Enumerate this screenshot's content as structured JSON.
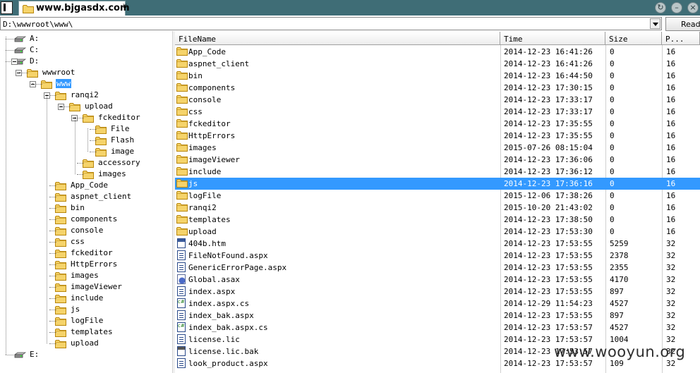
{
  "window": {
    "tab_title": "www.bjgasdx.com",
    "tab_close": "x",
    "btn_refresh": "↻",
    "btn_minimize": "–",
    "btn_close": "×"
  },
  "address": {
    "path": "D:\\wwwroot\\www\\",
    "read_button": "Read"
  },
  "tree": [
    {
      "label": "A:",
      "type": "drive",
      "depth": 0
    },
    {
      "label": "C:",
      "type": "drive",
      "depth": 0
    },
    {
      "label": "D:",
      "type": "drive",
      "depth": 0,
      "expanded": true
    },
    {
      "label": "wwwroot",
      "type": "folder",
      "depth": 1,
      "expanded": true
    },
    {
      "label": "www",
      "type": "folder",
      "depth": 2,
      "expanded": true,
      "selected": true
    },
    {
      "label": "ranqi2",
      "type": "folder",
      "depth": 3,
      "expanded": true
    },
    {
      "label": "upload",
      "type": "folder",
      "depth": 4,
      "expanded": true
    },
    {
      "label": "fckeditor",
      "type": "folder",
      "depth": 5,
      "expanded": true
    },
    {
      "label": "File",
      "type": "folder",
      "depth": 6
    },
    {
      "label": "Flash",
      "type": "folder",
      "depth": 6
    },
    {
      "label": "image",
      "type": "folder",
      "depth": 6
    },
    {
      "label": "accessory",
      "type": "folder",
      "depth": 5
    },
    {
      "label": "images",
      "type": "folder",
      "depth": 5
    },
    {
      "label": "App_Code",
      "type": "folder",
      "depth": 3
    },
    {
      "label": "aspnet_client",
      "type": "folder",
      "depth": 3
    },
    {
      "label": "bin",
      "type": "folder",
      "depth": 3
    },
    {
      "label": "components",
      "type": "folder",
      "depth": 3
    },
    {
      "label": "console",
      "type": "folder",
      "depth": 3
    },
    {
      "label": "css",
      "type": "folder",
      "depth": 3
    },
    {
      "label": "fckeditor",
      "type": "folder",
      "depth": 3
    },
    {
      "label": "HttpErrors",
      "type": "folder",
      "depth": 3
    },
    {
      "label": "images",
      "type": "folder",
      "depth": 3
    },
    {
      "label": "imageViewer",
      "type": "folder",
      "depth": 3
    },
    {
      "label": "include",
      "type": "folder",
      "depth": 3
    },
    {
      "label": "js",
      "type": "folder",
      "depth": 3
    },
    {
      "label": "logFile",
      "type": "folder",
      "depth": 3
    },
    {
      "label": "templates",
      "type": "folder",
      "depth": 3
    },
    {
      "label": "upload",
      "type": "folder",
      "depth": 3
    },
    {
      "label": "E:",
      "type": "drive",
      "depth": 0
    }
  ],
  "list": {
    "columns": [
      "FileName",
      "Time",
      "Size",
      "P..."
    ],
    "rows": [
      {
        "name": "App_Code",
        "time": "2014-12-23 16:41:26",
        "size": "0",
        "p": "16",
        "icon": "folder"
      },
      {
        "name": "aspnet_client",
        "time": "2014-12-23 16:41:26",
        "size": "0",
        "p": "16",
        "icon": "folder"
      },
      {
        "name": "bin",
        "time": "2014-12-23 16:44:50",
        "size": "0",
        "p": "16",
        "icon": "folder"
      },
      {
        "name": "components",
        "time": "2014-12-23 17:30:15",
        "size": "0",
        "p": "16",
        "icon": "folder"
      },
      {
        "name": "console",
        "time": "2014-12-23 17:33:17",
        "size": "0",
        "p": "16",
        "icon": "folder"
      },
      {
        "name": "css",
        "time": "2014-12-23 17:33:17",
        "size": "0",
        "p": "16",
        "icon": "folder"
      },
      {
        "name": "fckeditor",
        "time": "2014-12-23 17:35:55",
        "size": "0",
        "p": "16",
        "icon": "folder"
      },
      {
        "name": "HttpErrors",
        "time": "2014-12-23 17:35:55",
        "size": "0",
        "p": "16",
        "icon": "folder"
      },
      {
        "name": "images",
        "time": "2015-07-26 08:15:04",
        "size": "0",
        "p": "16",
        "icon": "folder"
      },
      {
        "name": "imageViewer",
        "time": "2014-12-23 17:36:06",
        "size": "0",
        "p": "16",
        "icon": "folder"
      },
      {
        "name": "include",
        "time": "2014-12-23 17:36:12",
        "size": "0",
        "p": "16",
        "icon": "folder"
      },
      {
        "name": "js",
        "time": "2014-12-23 17:36:16",
        "size": "0",
        "p": "16",
        "icon": "folder",
        "selected": true
      },
      {
        "name": "logFile",
        "time": "2015-12-06 17:38:26",
        "size": "0",
        "p": "16",
        "icon": "folder"
      },
      {
        "name": "ranqi2",
        "time": "2015-10-20 21:43:02",
        "size": "0",
        "p": "16",
        "icon": "folder"
      },
      {
        "name": "templates",
        "time": "2014-12-23 17:38:50",
        "size": "0",
        "p": "16",
        "icon": "folder"
      },
      {
        "name": "upload",
        "time": "2014-12-23 17:53:30",
        "size": "0",
        "p": "16",
        "icon": "folder"
      },
      {
        "name": "404b.htm",
        "time": "2014-12-23 17:53:55",
        "size": "5259",
        "p": "32",
        "icon": "htm"
      },
      {
        "name": "FileNotFound.aspx",
        "time": "2014-12-23 17:53:55",
        "size": "2378",
        "p": "32",
        "icon": "aspx"
      },
      {
        "name": "GenericErrorPage.aspx",
        "time": "2014-12-23 17:53:55",
        "size": "2355",
        "p": "32",
        "icon": "aspx"
      },
      {
        "name": "Global.asax",
        "time": "2014-12-23 17:53:55",
        "size": "4170",
        "p": "32",
        "icon": "asax"
      },
      {
        "name": "index.aspx",
        "time": "2014-12-23 17:53:55",
        "size": "897",
        "p": "32",
        "icon": "aspx"
      },
      {
        "name": "index.aspx.cs",
        "time": "2014-12-29 11:54:23",
        "size": "4527",
        "p": "32",
        "icon": "cs"
      },
      {
        "name": "index_bak.aspx",
        "time": "2014-12-23 17:53:55",
        "size": "897",
        "p": "32",
        "icon": "aspx"
      },
      {
        "name": "index_bak.aspx.cs",
        "time": "2014-12-23 17:53:57",
        "size": "4527",
        "p": "32",
        "icon": "cs"
      },
      {
        "name": "license.lic",
        "time": "2014-12-23 17:53:57",
        "size": "1004",
        "p": "32",
        "icon": "lic"
      },
      {
        "name": "license.lic.bak",
        "time": "2014-12-23 17:53:57",
        "size": "",
        "p": "32",
        "icon": "bak"
      },
      {
        "name": "look_product.aspx",
        "time": "2014-12-23 17:53:57",
        "size": "109",
        "p": "32",
        "icon": "aspx"
      }
    ]
  },
  "watermark": "www.wooyun.org",
  "colors": {
    "titlebar": "#3f6d76",
    "selection": "#3399ff",
    "folder_fill": "#f5d36a",
    "folder_stroke": "#b8860b"
  }
}
